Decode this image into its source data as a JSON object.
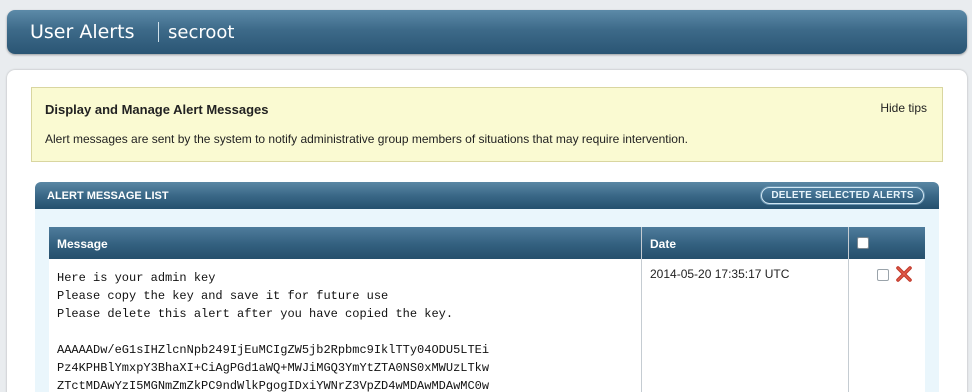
{
  "header": {
    "title": "User Alerts",
    "user": "secroot"
  },
  "tips": {
    "heading": "Display and Manage Alert Messages",
    "hide_label": "Hide tips",
    "description": "Alert messages are sent by the system to notify administrative group members of situations that may require intervention."
  },
  "alert_list": {
    "title": "ALERT MESSAGE LIST",
    "delete_button_label": "DELETE SELECTED ALERTS",
    "columns": {
      "message": "Message",
      "date": "Date"
    },
    "rows": [
      {
        "message": "Here is your admin key\nPlease copy the key and save it for future use\nPlease delete this alert after you have copied the key.\n\nAAAAADw/eG1sIHZlcnNpb249IjEuMCIgZW5jb2Rpbmc9IklTTy04ODU5LTEi\nPz4KPHBlYmxpY3BhaXI+CiAgPGd1aWQ+MWJiMGQ3YmYtZTA0NS0xMWUzLTkw\nZTctMDAwYzI5MGNmZmZkPC9ndWlkPgogIDxiYWNrZ3VpZD4wMDAwMDAwMC0w",
        "date": "2014-05-20 17:35:17 UTC"
      }
    ]
  },
  "icons": {
    "delete": "close-x-icon",
    "delete_color": "#c0392b"
  }
}
